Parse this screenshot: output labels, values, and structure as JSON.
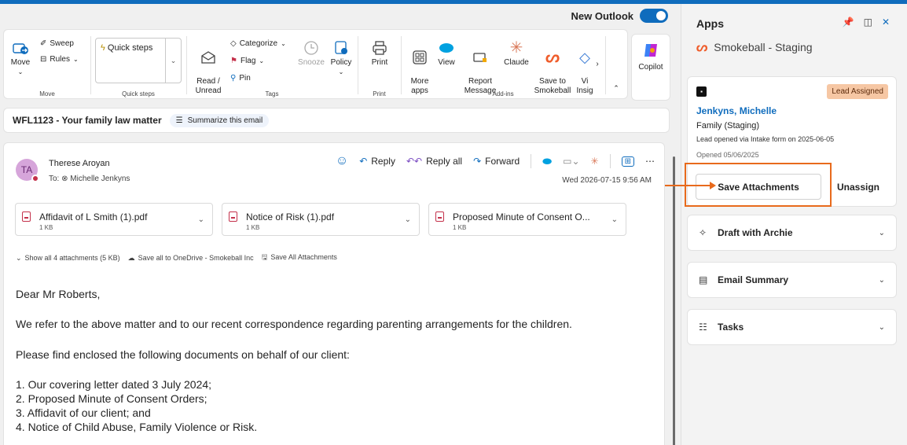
{
  "header": {
    "new_outlook_label": "New Outlook"
  },
  "ribbon": {
    "move": {
      "sweep": "Sweep",
      "rules": "Rules",
      "move": "Move",
      "group": "Move"
    },
    "quick_steps": {
      "label": "Quick steps",
      "group": "Quick steps"
    },
    "tags": {
      "read_unread": "Read /\nUnread",
      "categorize": "Categorize",
      "flag": "Flag",
      "pin": "Pin",
      "snooze": "Snooze",
      "policy": "Policy",
      "group": "Tags"
    },
    "print": {
      "label": "Print",
      "group": "Print"
    },
    "addins": {
      "more_apps": "More\napps",
      "view": "View",
      "report": "Report\nMessage",
      "claude": "Claude",
      "save_to_smokeball": "Save to\nSmokeball",
      "vi": "Vi\nInsig",
      "group": "Add-ins"
    },
    "copilot": "Copilot"
  },
  "subject": {
    "text": "WFL1123 - Your family law matter",
    "summarize": "Summarize this email"
  },
  "email": {
    "avatar_initials": "TA",
    "sender": "Therese Aroyan",
    "to": "To: ⊗ Michelle Jenkyns",
    "actions": {
      "reply": "Reply",
      "reply_all": "Reply all",
      "forward": "Forward"
    },
    "date": "Wed 2026-07-15 9:56 AM",
    "attachments": [
      {
        "name": "Affidavit of L Smith (1).pdf",
        "size": "1 KB"
      },
      {
        "name": "Notice of Risk (1).pdf",
        "size": "1 KB"
      },
      {
        "name": "Proposed Minute of Consent O...",
        "size": "1 KB"
      }
    ],
    "links": {
      "show_all": "Show all 4 attachments (5 KB)",
      "onedrive": "Save all to OneDrive - Smokeball Inc",
      "save_all": "Save All Attachments"
    },
    "body": [
      "Dear Mr Roberts,",
      "We refer to the above matter and to our recent correspondence regarding parenting arrangements for the children.",
      "Please find enclosed the following documents on behalf of our client:",
      "1. Our covering letter dated 3 July 2024;",
      "2. Proposed Minute of Consent Orders;",
      "3. Affidavit of our client; and",
      "4. Notice of Child Abuse, Family Violence or Risk."
    ]
  },
  "panel": {
    "title": "Apps",
    "app_name": "Smokeball - Staging",
    "lead": {
      "badge": "Lead Assigned",
      "name": "Jenkyns, Michelle",
      "type": "Family (Staging)",
      "note": "Lead opened via Intake form on 2025-06-05",
      "opened": "Opened 05/06/2025",
      "save_attachments": "Save Attachments",
      "unassign": "Unassign"
    },
    "sections": [
      {
        "label": "Draft with Archie",
        "icon": "sparkle-icon"
      },
      {
        "label": "Email Summary",
        "icon": "document-icon"
      },
      {
        "label": "Tasks",
        "icon": "list-icon"
      }
    ]
  },
  "colors": {
    "accent": "#0f6cbd",
    "highlight": "#e86a1c",
    "badge_bg": "#f6c7a4"
  }
}
